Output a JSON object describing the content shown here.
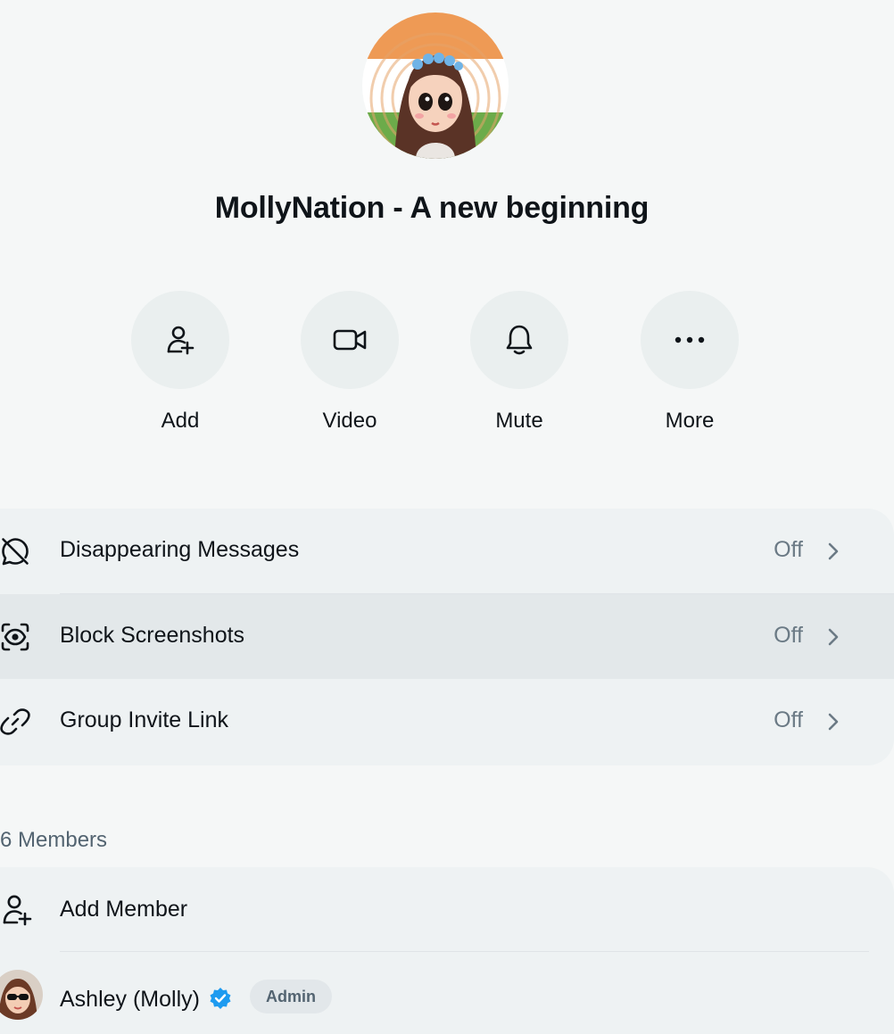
{
  "group": {
    "name": "MollyNation - A new beginning",
    "avatar_icon": "group-avatar-cartoon-girl-tricolor"
  },
  "actions": [
    {
      "label": "Add",
      "icon": "add-person-icon"
    },
    {
      "label": "Video",
      "icon": "video-camera-icon"
    },
    {
      "label": "Mute",
      "icon": "bell-icon"
    },
    {
      "label": "More",
      "icon": "more-dots-icon"
    }
  ],
  "settings": [
    {
      "label": "Disappearing Messages",
      "value": "Off",
      "icon": "disappearing-messages-icon"
    },
    {
      "label": "Block Screenshots",
      "value": "Off",
      "icon": "block-screenshots-icon"
    },
    {
      "label": "Group Invite Link",
      "value": "Off",
      "icon": "link-icon"
    }
  ],
  "members": {
    "count_label": "6 Members",
    "add_member_label": "Add Member",
    "list": [
      {
        "name": "Ashley (Molly)",
        "verified": true,
        "role": "Admin"
      }
    ]
  },
  "colors": {
    "background": "#f5f7f7",
    "card": "#eef2f3",
    "row_hover": "#e3e8ea",
    "muted_text": "#536471",
    "verified_blue": "#1d9bf0"
  }
}
